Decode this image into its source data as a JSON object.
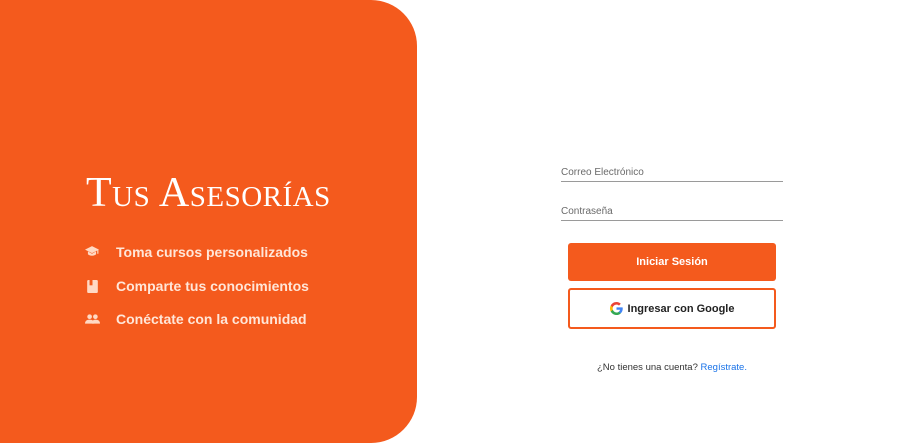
{
  "brand": {
    "title": "Tus Asesorías"
  },
  "features": [
    {
      "icon": "graduation-cap-icon",
      "label": "Toma cursos personalizados"
    },
    {
      "icon": "book-icon",
      "label": "Comparte tus conocimientos"
    },
    {
      "icon": "people-icon",
      "label": "Conéctate con la comunidad"
    }
  ],
  "login": {
    "email_placeholder": "Correo Electrónico",
    "email_value": "",
    "password_placeholder": "Contraseña",
    "password_value": "",
    "submit_label": "Iniciar Sesión",
    "google_label": "Ingresar con Google",
    "google_icon": "google-icon",
    "signup_prompt": "¿No tienes una cuenta?",
    "signup_link": "Regístrate."
  },
  "colors": {
    "accent": "#f45a1d",
    "link": "#1a73e8",
    "white": "#ffffff"
  }
}
